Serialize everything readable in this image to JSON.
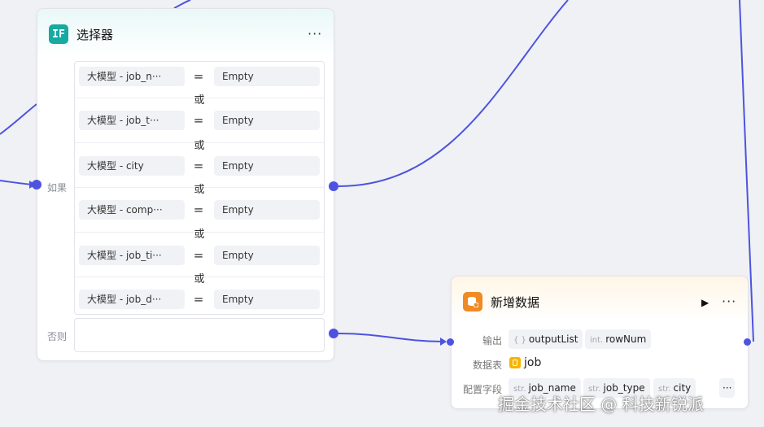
{
  "selector_node": {
    "icon_text": "IF",
    "title": "选择器",
    "more": "···",
    "if_label": "如果",
    "else_label": "否则",
    "or_label": "或",
    "conditions": [
      {
        "left": "大模型  -  job_n···",
        "op": "=",
        "right": "Empty"
      },
      {
        "left": "大模型  -  job_t···",
        "op": "=",
        "right": "Empty"
      },
      {
        "left": "大模型  -  city",
        "op": "=",
        "right": "Empty"
      },
      {
        "left": "大模型  -  comp···",
        "op": "=",
        "right": "Empty"
      },
      {
        "left": "大模型  -  job_ti···",
        "op": "=",
        "right": "Empty"
      },
      {
        "left": "大模型  -  job_d···",
        "op": "=",
        "right": "Empty"
      }
    ]
  },
  "insert_node": {
    "title": "新增数据",
    "more": "···",
    "play": "▶",
    "output_label": "输出",
    "outputs": [
      {
        "type": "{ }",
        "name": "outputList"
      },
      {
        "type": "int.",
        "name": "rowNum"
      }
    ],
    "table_label": "数据表",
    "table_name": "job",
    "fields_label": "配置字段",
    "fields": [
      {
        "type": "str.",
        "name": "job_name"
      },
      {
        "type": "str.",
        "name": "job_type"
      },
      {
        "type": "str.",
        "name": "city"
      }
    ],
    "fields_more": "···"
  },
  "watermark": "掘金技术社区 @ 科技新锐派",
  "colors": {
    "edge": "#4d53e0",
    "selector_icon": "#16aaa1",
    "insert_icon": "#f08a24"
  }
}
